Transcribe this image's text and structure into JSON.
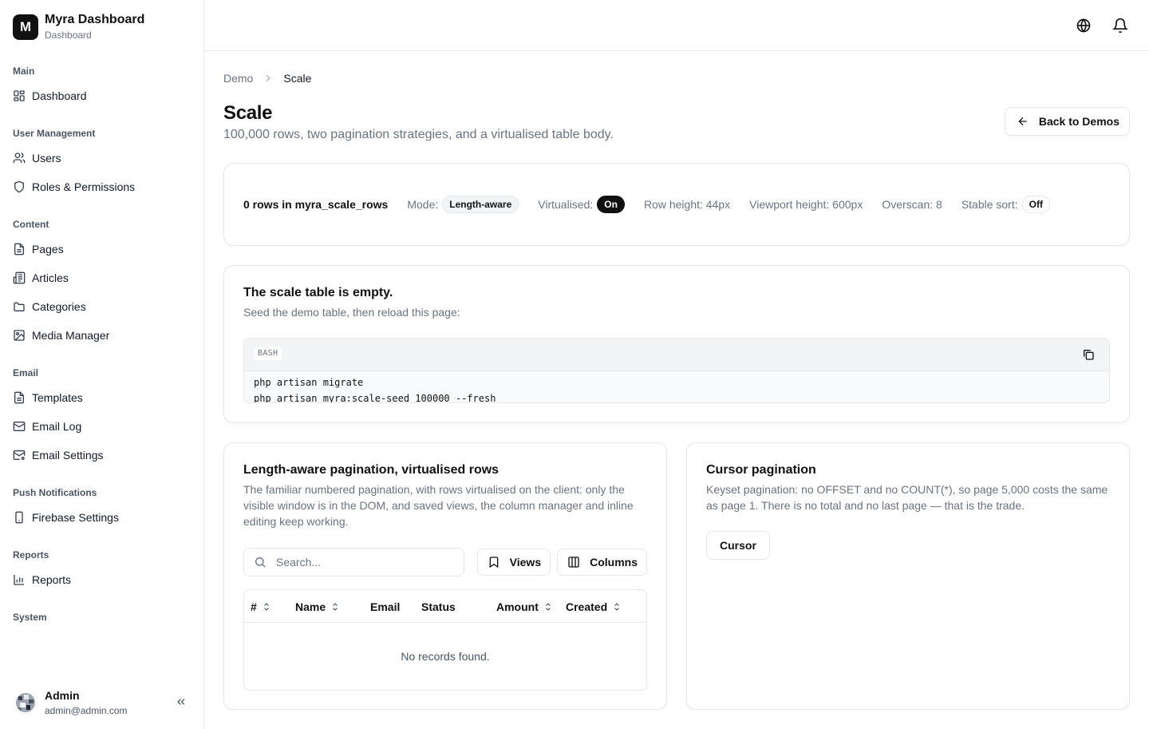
{
  "app": {
    "logo_letter": "M",
    "title": "Myra Dashboard",
    "subtitle": "Dashboard"
  },
  "sidebar": {
    "groups": [
      {
        "label": "Main",
        "items": [
          {
            "label": "Dashboard",
            "icon": "dashboard-icon"
          }
        ]
      },
      {
        "label": "User Management",
        "items": [
          {
            "label": "Users",
            "icon": "users-icon"
          },
          {
            "label": "Roles & Permissions",
            "icon": "shield-icon"
          }
        ]
      },
      {
        "label": "Content",
        "items": [
          {
            "label": "Pages",
            "icon": "file-icon"
          },
          {
            "label": "Articles",
            "icon": "newspaper-icon"
          },
          {
            "label": "Categories",
            "icon": "folder-icon"
          },
          {
            "label": "Media Manager",
            "icon": "image-icon"
          }
        ]
      },
      {
        "label": "Email",
        "items": [
          {
            "label": "Templates",
            "icon": "file-icon"
          },
          {
            "label": "Email Log",
            "icon": "mail-icon"
          },
          {
            "label": "Email Settings",
            "icon": "mail-settings-icon"
          }
        ]
      },
      {
        "label": "Push Notifications",
        "items": [
          {
            "label": "Firebase Settings",
            "icon": "phone-icon"
          }
        ]
      },
      {
        "label": "Reports",
        "items": [
          {
            "label": "Reports",
            "icon": "bar-chart-icon"
          }
        ]
      },
      {
        "label": "System",
        "items": []
      }
    ],
    "user": {
      "name": "Admin",
      "email": "admin@admin.com"
    }
  },
  "topbar": {
    "icons": [
      "globe-icon",
      "bell-icon"
    ]
  },
  "breadcrumb": {
    "parent": "Demo",
    "current": "Scale"
  },
  "page": {
    "title": "Scale",
    "subtitle": "100,000 rows, two pagination strategies, and a virtualised table body.",
    "back_label": "Back to Demos"
  },
  "stats": {
    "rows": "0 rows in myra_scale_rows",
    "mode_label": "Mode:",
    "mode_value": "Length-aware",
    "virtualised_label": "Virtualised:",
    "virtualised_value": "On",
    "row_height": "Row height: 44px",
    "viewport_height": "Viewport height: 600px",
    "overscan": "Overscan: 8",
    "stable_sort_label": "Stable sort:",
    "stable_sort_value": "Off"
  },
  "empty_state": {
    "title": "The scale table is empty.",
    "description": "Seed the demo table, then reload this page:",
    "code_lang": "BASH",
    "code_lines": [
      "php artisan migrate",
      "php artisan myra:scale-seed 100000 --fresh"
    ]
  },
  "length_aware": {
    "title": "Length-aware pagination, virtualised rows",
    "description": "The familiar numbered pagination, with rows virtualised on the client: only the visible window is in the DOM, and saved views, the column manager and inline editing keep working.",
    "search_placeholder": "Search...",
    "views_label": "Views",
    "columns_label": "Columns",
    "columns": [
      {
        "label": "#",
        "sortable": true
      },
      {
        "label": "Name",
        "sortable": true
      },
      {
        "label": "Email",
        "sortable": false
      },
      {
        "label": "Status",
        "sortable": false
      },
      {
        "label": "Amount",
        "sortable": true
      },
      {
        "label": "Created",
        "sortable": true
      }
    ],
    "empty_message": "No records found."
  },
  "cursor": {
    "title": "Cursor pagination",
    "description": "Keyset pagination: no OFFSET and no COUNT(*), so page 5,000 costs the same as page 1. There is no total and no last page — that is the trade.",
    "button_label": "Cursor"
  }
}
